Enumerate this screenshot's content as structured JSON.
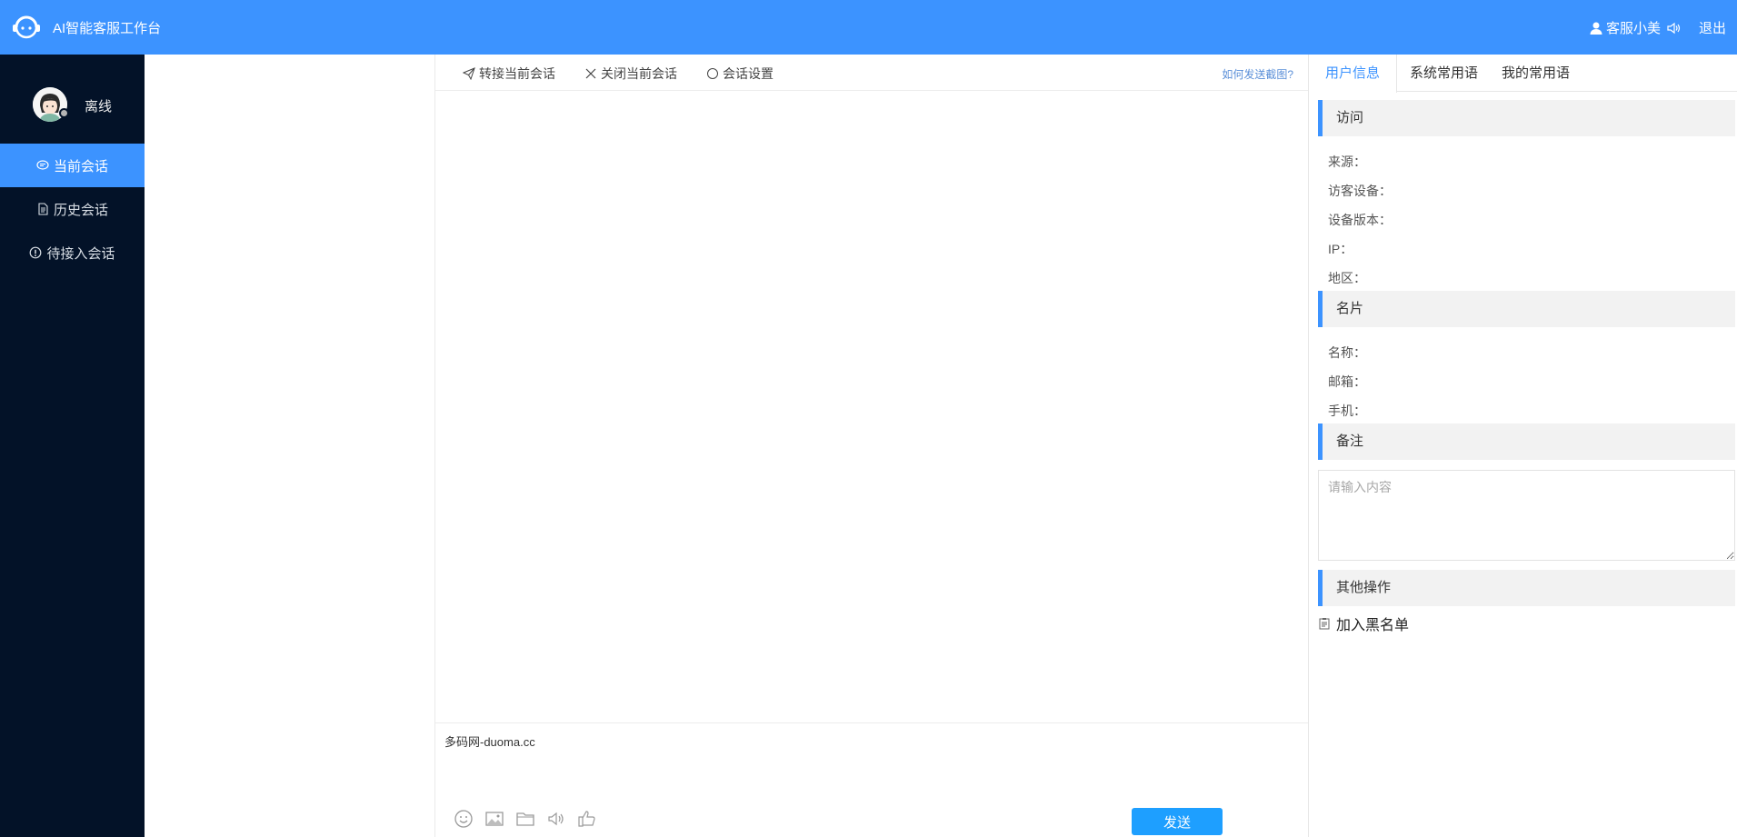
{
  "header": {
    "app_title": "AI智能客服工作台",
    "agent_name": "客服小美",
    "logout_label": "退出",
    "bg_color": "#3c93ff"
  },
  "sidebar": {
    "status": "离线",
    "items": [
      {
        "label": "当前会话",
        "icon": "chat-icon",
        "active": true
      },
      {
        "label": "历史会话",
        "icon": "document-icon",
        "active": false
      },
      {
        "label": "待接入会话",
        "icon": "info-icon",
        "active": false
      }
    ]
  },
  "chat": {
    "toolbar": {
      "transfer_label": "转接当前会话",
      "close_label": "关闭当前会话",
      "settings_label": "会话设置",
      "help_label": "如何发送截图?"
    },
    "input_text": "多码网-duoma.cc",
    "input_tools": [
      "emoji-icon",
      "image-icon",
      "folder-icon",
      "sound-icon",
      "thumbs-up-icon"
    ],
    "send_label": "发送"
  },
  "right_panel": {
    "tabs": [
      {
        "label": "用户信息",
        "active": true
      },
      {
        "label": "系统常用语",
        "active": false
      },
      {
        "label": "我的常用语",
        "active": false
      }
    ],
    "visit": {
      "title": "访问",
      "fields": [
        "来源：",
        "访客设备：",
        "设备版本：",
        "IP：",
        "地区："
      ]
    },
    "card": {
      "title": "名片",
      "fields": [
        "名称：",
        "邮箱：",
        "手机："
      ]
    },
    "remark": {
      "title": "备注",
      "placeholder": "请输入内容"
    },
    "other": {
      "title": "其他操作",
      "blacklist_label": "加入黑名单"
    }
  }
}
